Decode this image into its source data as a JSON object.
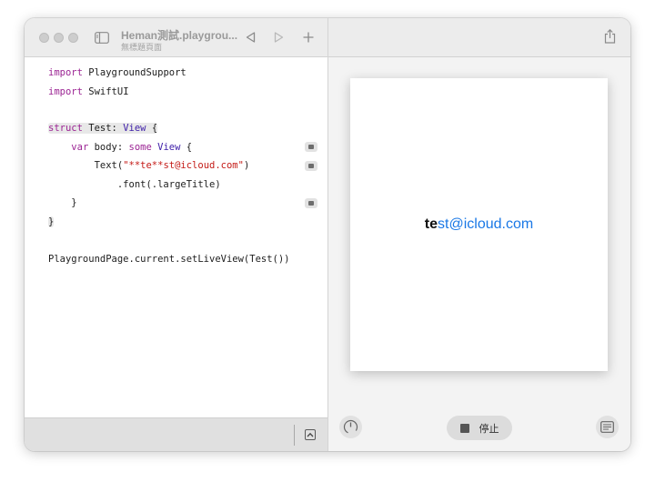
{
  "window": {
    "title": "Heman測試.playgrou...",
    "subtitle": "無標題頁面"
  },
  "editor": {
    "lines": [
      {
        "kw": "import",
        "rest": " PlaygroundSupport"
      },
      {
        "kw": "import",
        "rest": " SwiftUI"
      },
      {
        "kw": "struct",
        "name": " Test: ",
        "type": "View",
        "tail": " {"
      },
      {
        "pre": "    ",
        "kw": "var",
        "name": " body: ",
        "kw2": "some",
        "sp": " ",
        "type": "View",
        "tail": " {"
      },
      {
        "pre": "        Text(",
        "str": "\"**te**st@icloud.com\"",
        "tail": ")"
      },
      {
        "text": "            .font(.largeTitle)"
      },
      {
        "text": "    }"
      },
      {
        "text": "}"
      },
      {
        "text": "PlaygroundPage.current.setLiveView(Test())"
      }
    ]
  },
  "liveview": {
    "text_bold": "te",
    "text_rest": "st@icloud.com",
    "stop_label": "停止"
  },
  "colors": {
    "keyword": "#9b2393",
    "type": "#3e1ea8",
    "string": "#c41a16",
    "link_blue": "#1a78e6"
  },
  "icons": [
    "sidebar-icon",
    "back-triangle-icon",
    "forward-triangle-icon",
    "plus-icon",
    "share-icon",
    "chevron-up-icon",
    "gauge-icon",
    "stop-icon",
    "console-icon",
    "result-icon"
  ]
}
